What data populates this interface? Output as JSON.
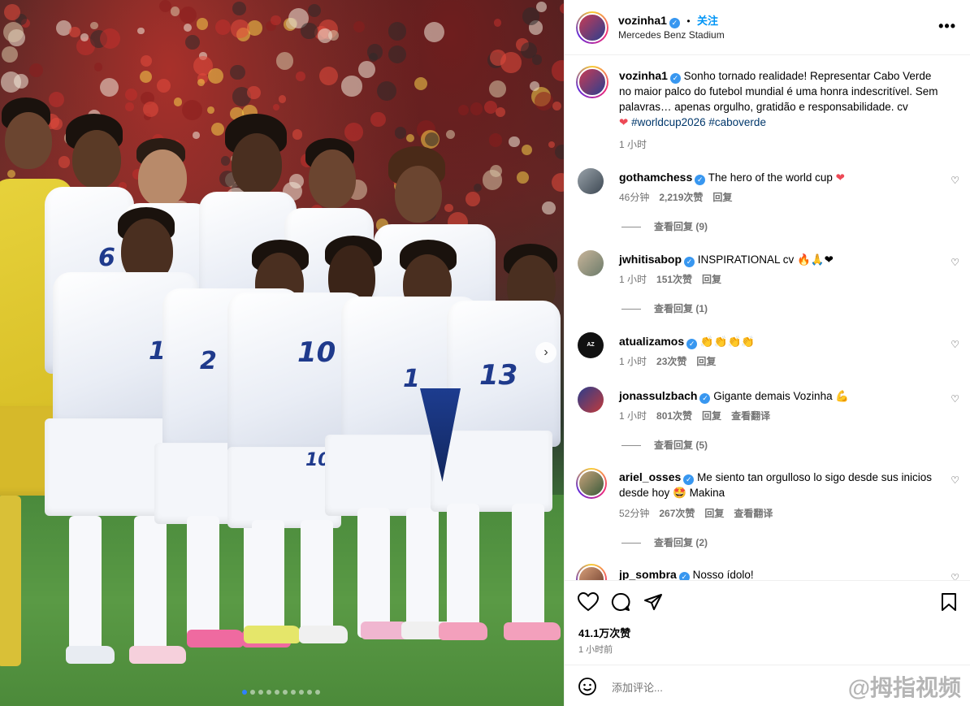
{
  "post": {
    "username": "vozinha1",
    "follow_label": "关注",
    "separator": "•",
    "location": "Mercedes Benz Stadium",
    "more_label": "•••"
  },
  "media": {
    "jersey_numbers": [
      "6",
      "13",
      "10",
      "2",
      "15",
      "2",
      "13",
      "1",
      "2",
      "10",
      "1"
    ],
    "next_label": "›",
    "dots_total": 10,
    "dots_active": 0
  },
  "caption": {
    "username": "vozinha1",
    "text": "Sonho tornado realidade! Representar Cabo Verde no maior palco do futebol mundial é uma honra indescritível. Sem palavras… apenas orgulho, gratidão e responsabilidade. cv",
    "heart": "❤",
    "hashtags": "#worldcup2026 #caboverde",
    "time": "1 小时"
  },
  "comments": [
    {
      "username": "gothamchess",
      "text": "The hero of the world cup",
      "emoji": "❤",
      "time": "46分钟",
      "likes": "2,219次赞",
      "reply": "回复",
      "translate": "",
      "view_replies": "查看回复 (9)"
    },
    {
      "username": "jwhitisabop",
      "text": "INSPIRATIONAL cv",
      "emoji": "🔥🙏❤",
      "time": "1 小时",
      "likes": "151次赞",
      "reply": "回复",
      "translate": "",
      "view_replies": "查看回复 (1)"
    },
    {
      "username": "atualizamos",
      "text": "",
      "emoji": "👏👏👏👏",
      "time": "1 小时",
      "likes": "23次赞",
      "reply": "回复",
      "translate": "",
      "view_replies": ""
    },
    {
      "username": "jonassulzbach",
      "text": "Gigante demais Vozinha",
      "emoji": "💪",
      "time": "1 小时",
      "likes": "801次赞",
      "reply": "回复",
      "translate": "查看翻译",
      "view_replies": "查看回复 (5)"
    },
    {
      "username": "ariel_osses",
      "text": "Me siento tan orgulloso󠀥 lo sigo desde sus inicios desde hoy",
      "emoji": "🤩",
      "extra": " Makina",
      "time": "52分钟",
      "likes": "267次赞",
      "reply": "回复",
      "translate": "查看翻译",
      "view_replies": "查看回复 (2)"
    },
    {
      "username": "jp_sombra",
      "text": "Nosso ídolo!",
      "emoji": "",
      "time": "",
      "likes": "",
      "reply": "",
      "translate": "",
      "view_replies": ""
    }
  ],
  "footer": {
    "likes": "41.1万次赞",
    "time": "1 小时前",
    "comment_placeholder": "添加评论...",
    "watermark": "@拇指视频"
  },
  "colors": {
    "accent": "#0095f6",
    "verified": "#3897f0",
    "heart": "#ed4956",
    "hashtag": "#00376b",
    "jersey_number": "#1f3a8c"
  }
}
